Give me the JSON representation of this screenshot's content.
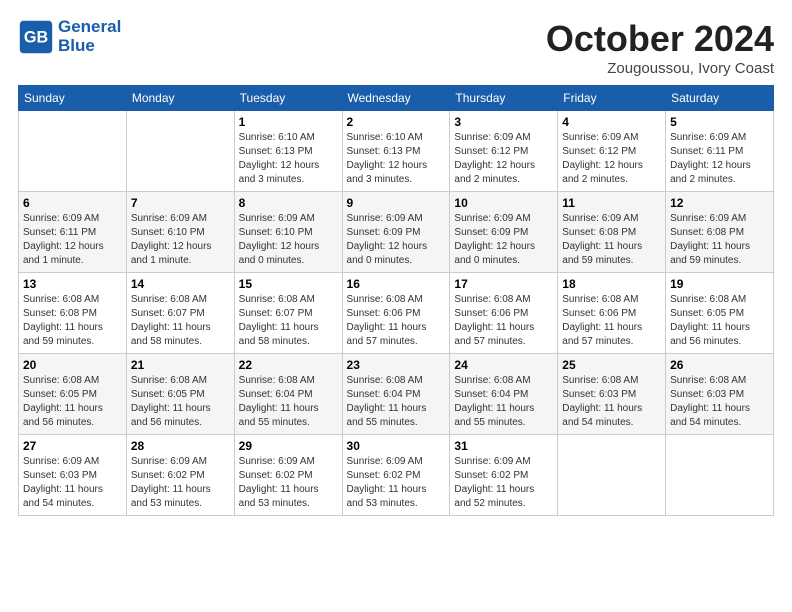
{
  "header": {
    "logo_line1": "General",
    "logo_line2": "Blue",
    "month": "October 2024",
    "location": "Zougoussou, Ivory Coast"
  },
  "weekdays": [
    "Sunday",
    "Monday",
    "Tuesday",
    "Wednesday",
    "Thursday",
    "Friday",
    "Saturday"
  ],
  "weeks": [
    [
      null,
      null,
      {
        "day": 1,
        "sunrise": "6:10 AM",
        "sunset": "6:13 PM",
        "daylight": "12 hours and 3 minutes."
      },
      {
        "day": 2,
        "sunrise": "6:10 AM",
        "sunset": "6:13 PM",
        "daylight": "12 hours and 3 minutes."
      },
      {
        "day": 3,
        "sunrise": "6:09 AM",
        "sunset": "6:12 PM",
        "daylight": "12 hours and 2 minutes."
      },
      {
        "day": 4,
        "sunrise": "6:09 AM",
        "sunset": "6:12 PM",
        "daylight": "12 hours and 2 minutes."
      },
      {
        "day": 5,
        "sunrise": "6:09 AM",
        "sunset": "6:11 PM",
        "daylight": "12 hours and 2 minutes."
      }
    ],
    [
      {
        "day": 6,
        "sunrise": "6:09 AM",
        "sunset": "6:11 PM",
        "daylight": "12 hours and 1 minute."
      },
      {
        "day": 7,
        "sunrise": "6:09 AM",
        "sunset": "6:10 PM",
        "daylight": "12 hours and 1 minute."
      },
      {
        "day": 8,
        "sunrise": "6:09 AM",
        "sunset": "6:10 PM",
        "daylight": "12 hours and 0 minutes."
      },
      {
        "day": 9,
        "sunrise": "6:09 AM",
        "sunset": "6:09 PM",
        "daylight": "12 hours and 0 minutes."
      },
      {
        "day": 10,
        "sunrise": "6:09 AM",
        "sunset": "6:09 PM",
        "daylight": "12 hours and 0 minutes."
      },
      {
        "day": 11,
        "sunrise": "6:09 AM",
        "sunset": "6:08 PM",
        "daylight": "11 hours and 59 minutes."
      },
      {
        "day": 12,
        "sunrise": "6:09 AM",
        "sunset": "6:08 PM",
        "daylight": "11 hours and 59 minutes."
      }
    ],
    [
      {
        "day": 13,
        "sunrise": "6:08 AM",
        "sunset": "6:08 PM",
        "daylight": "11 hours and 59 minutes."
      },
      {
        "day": 14,
        "sunrise": "6:08 AM",
        "sunset": "6:07 PM",
        "daylight": "11 hours and 58 minutes."
      },
      {
        "day": 15,
        "sunrise": "6:08 AM",
        "sunset": "6:07 PM",
        "daylight": "11 hours and 58 minutes."
      },
      {
        "day": 16,
        "sunrise": "6:08 AM",
        "sunset": "6:06 PM",
        "daylight": "11 hours and 57 minutes."
      },
      {
        "day": 17,
        "sunrise": "6:08 AM",
        "sunset": "6:06 PM",
        "daylight": "11 hours and 57 minutes."
      },
      {
        "day": 18,
        "sunrise": "6:08 AM",
        "sunset": "6:06 PM",
        "daylight": "11 hours and 57 minutes."
      },
      {
        "day": 19,
        "sunrise": "6:08 AM",
        "sunset": "6:05 PM",
        "daylight": "11 hours and 56 minutes."
      }
    ],
    [
      {
        "day": 20,
        "sunrise": "6:08 AM",
        "sunset": "6:05 PM",
        "daylight": "11 hours and 56 minutes."
      },
      {
        "day": 21,
        "sunrise": "6:08 AM",
        "sunset": "6:05 PM",
        "daylight": "11 hours and 56 minutes."
      },
      {
        "day": 22,
        "sunrise": "6:08 AM",
        "sunset": "6:04 PM",
        "daylight": "11 hours and 55 minutes."
      },
      {
        "day": 23,
        "sunrise": "6:08 AM",
        "sunset": "6:04 PM",
        "daylight": "11 hours and 55 minutes."
      },
      {
        "day": 24,
        "sunrise": "6:08 AM",
        "sunset": "6:04 PM",
        "daylight": "11 hours and 55 minutes."
      },
      {
        "day": 25,
        "sunrise": "6:08 AM",
        "sunset": "6:03 PM",
        "daylight": "11 hours and 54 minutes."
      },
      {
        "day": 26,
        "sunrise": "6:08 AM",
        "sunset": "6:03 PM",
        "daylight": "11 hours and 54 minutes."
      }
    ],
    [
      {
        "day": 27,
        "sunrise": "6:09 AM",
        "sunset": "6:03 PM",
        "daylight": "11 hours and 54 minutes."
      },
      {
        "day": 28,
        "sunrise": "6:09 AM",
        "sunset": "6:02 PM",
        "daylight": "11 hours and 53 minutes."
      },
      {
        "day": 29,
        "sunrise": "6:09 AM",
        "sunset": "6:02 PM",
        "daylight": "11 hours and 53 minutes."
      },
      {
        "day": 30,
        "sunrise": "6:09 AM",
        "sunset": "6:02 PM",
        "daylight": "11 hours and 53 minutes."
      },
      {
        "day": 31,
        "sunrise": "6:09 AM",
        "sunset": "6:02 PM",
        "daylight": "11 hours and 52 minutes."
      },
      null,
      null
    ]
  ]
}
